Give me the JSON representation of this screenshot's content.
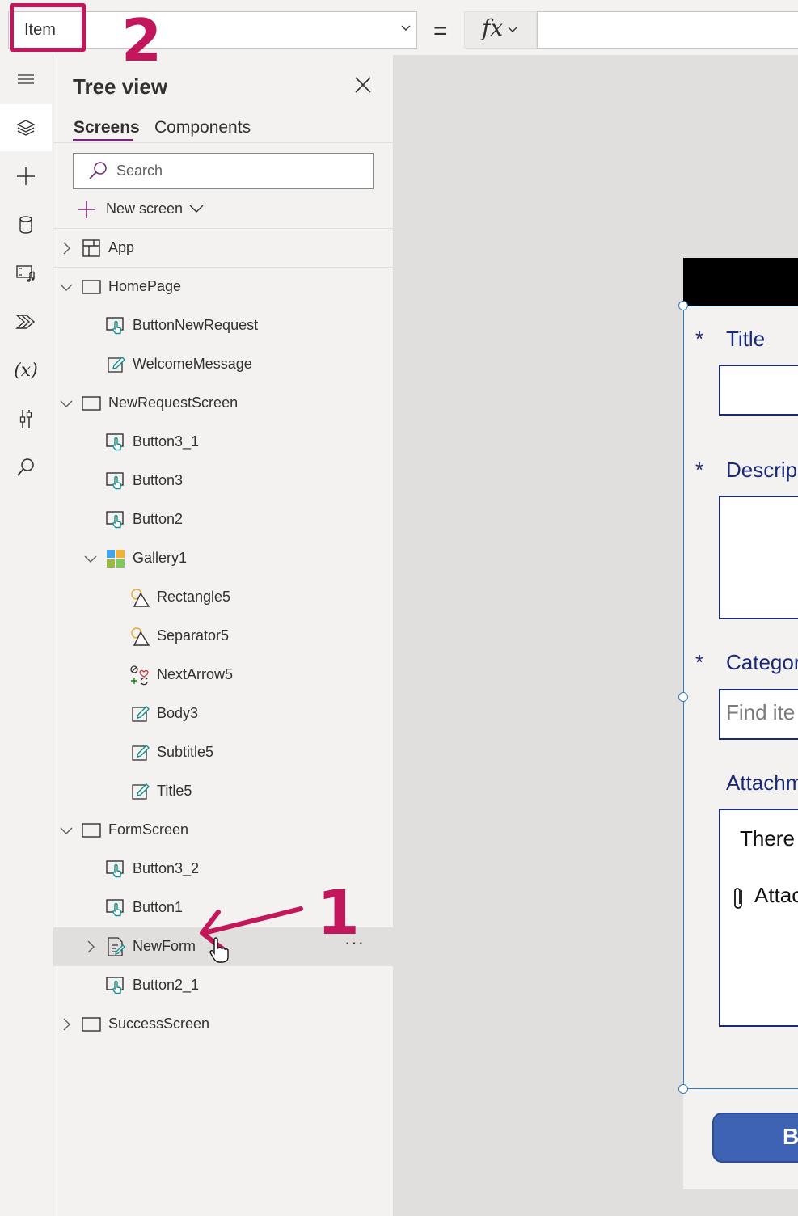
{
  "formula_bar": {
    "property": "Item",
    "equals": "=",
    "fx_label": "fx"
  },
  "annotations": {
    "label_one": "1",
    "label_two": "2",
    "color": "#c2185b"
  },
  "left_rail": {
    "items": [
      "menu-icon",
      "layers-icon",
      "plus-icon",
      "database-icon",
      "media-icon",
      "power-automate-icon",
      "variables-icon",
      "tools-icon",
      "search-icon"
    ],
    "variables_text": "(x)"
  },
  "tree_view": {
    "title": "Tree view",
    "tabs": [
      {
        "label": "Screens",
        "active": true
      },
      {
        "label": "Components",
        "active": false
      }
    ],
    "search_placeholder": "Search",
    "new_screen_label": "New screen",
    "accent_color": "#742774",
    "items": [
      {
        "label": "App",
        "icon": "app-icon",
        "depth": 0,
        "expander": "collapsed"
      },
      {
        "label": "HomePage",
        "icon": "screen-icon",
        "depth": 0,
        "expander": "expanded"
      },
      {
        "label": "ButtonNewRequest",
        "icon": "button-icon",
        "depth": 1,
        "expander": "none"
      },
      {
        "label": "WelcomeMessage",
        "icon": "label-icon",
        "depth": 1,
        "expander": "none"
      },
      {
        "label": "NewRequestScreen",
        "icon": "screen-icon",
        "depth": 0,
        "expander": "expanded"
      },
      {
        "label": "Button3_1",
        "icon": "button-icon",
        "depth": 1,
        "expander": "none"
      },
      {
        "label": "Button3",
        "icon": "button-icon",
        "depth": 1,
        "expander": "none"
      },
      {
        "label": "Button2",
        "icon": "button-icon",
        "depth": 1,
        "expander": "none"
      },
      {
        "label": "Gallery1",
        "icon": "gallery-icon",
        "depth": 1,
        "expander": "expanded"
      },
      {
        "label": "Rectangle5",
        "icon": "shape-icon",
        "depth": 2,
        "expander": "none"
      },
      {
        "label": "Separator5",
        "icon": "shape-icon",
        "depth": 2,
        "expander": "none"
      },
      {
        "label": "NextArrow5",
        "icon": "icons-icon",
        "depth": 2,
        "expander": "none"
      },
      {
        "label": "Body3",
        "icon": "label-icon",
        "depth": 2,
        "expander": "none"
      },
      {
        "label": "Subtitle5",
        "icon": "label-icon",
        "depth": 2,
        "expander": "none"
      },
      {
        "label": "Title5",
        "icon": "label-icon",
        "depth": 2,
        "expander": "none"
      },
      {
        "label": "FormScreen",
        "icon": "screen-icon",
        "depth": 0,
        "expander": "expanded"
      },
      {
        "label": "Button3_2",
        "icon": "button-icon",
        "depth": 1,
        "expander": "none"
      },
      {
        "label": "Button1",
        "icon": "button-icon",
        "depth": 1,
        "expander": "none"
      },
      {
        "label": "NewForm",
        "icon": "form-icon",
        "depth": 1,
        "expander": "collapsed",
        "selected": true,
        "more": "···"
      },
      {
        "label": "Button2_1",
        "icon": "button-icon",
        "depth": 1,
        "expander": "none"
      },
      {
        "label": "SuccessScreen",
        "icon": "screen-icon",
        "depth": 0,
        "expander": "collapsed"
      }
    ]
  },
  "canvas_form": {
    "required_mark": "*",
    "fields": {
      "title": "Title",
      "description": "Descrip",
      "category": "Categor",
      "attachments": "Attachm"
    },
    "category_placeholder": "Find ite",
    "attachments_text": "There",
    "attach_link": "Attac",
    "submit_label": "B",
    "label_color": "#1b2a77",
    "button_color": "#3e63b5",
    "selection_color": "#2d7cc0"
  }
}
